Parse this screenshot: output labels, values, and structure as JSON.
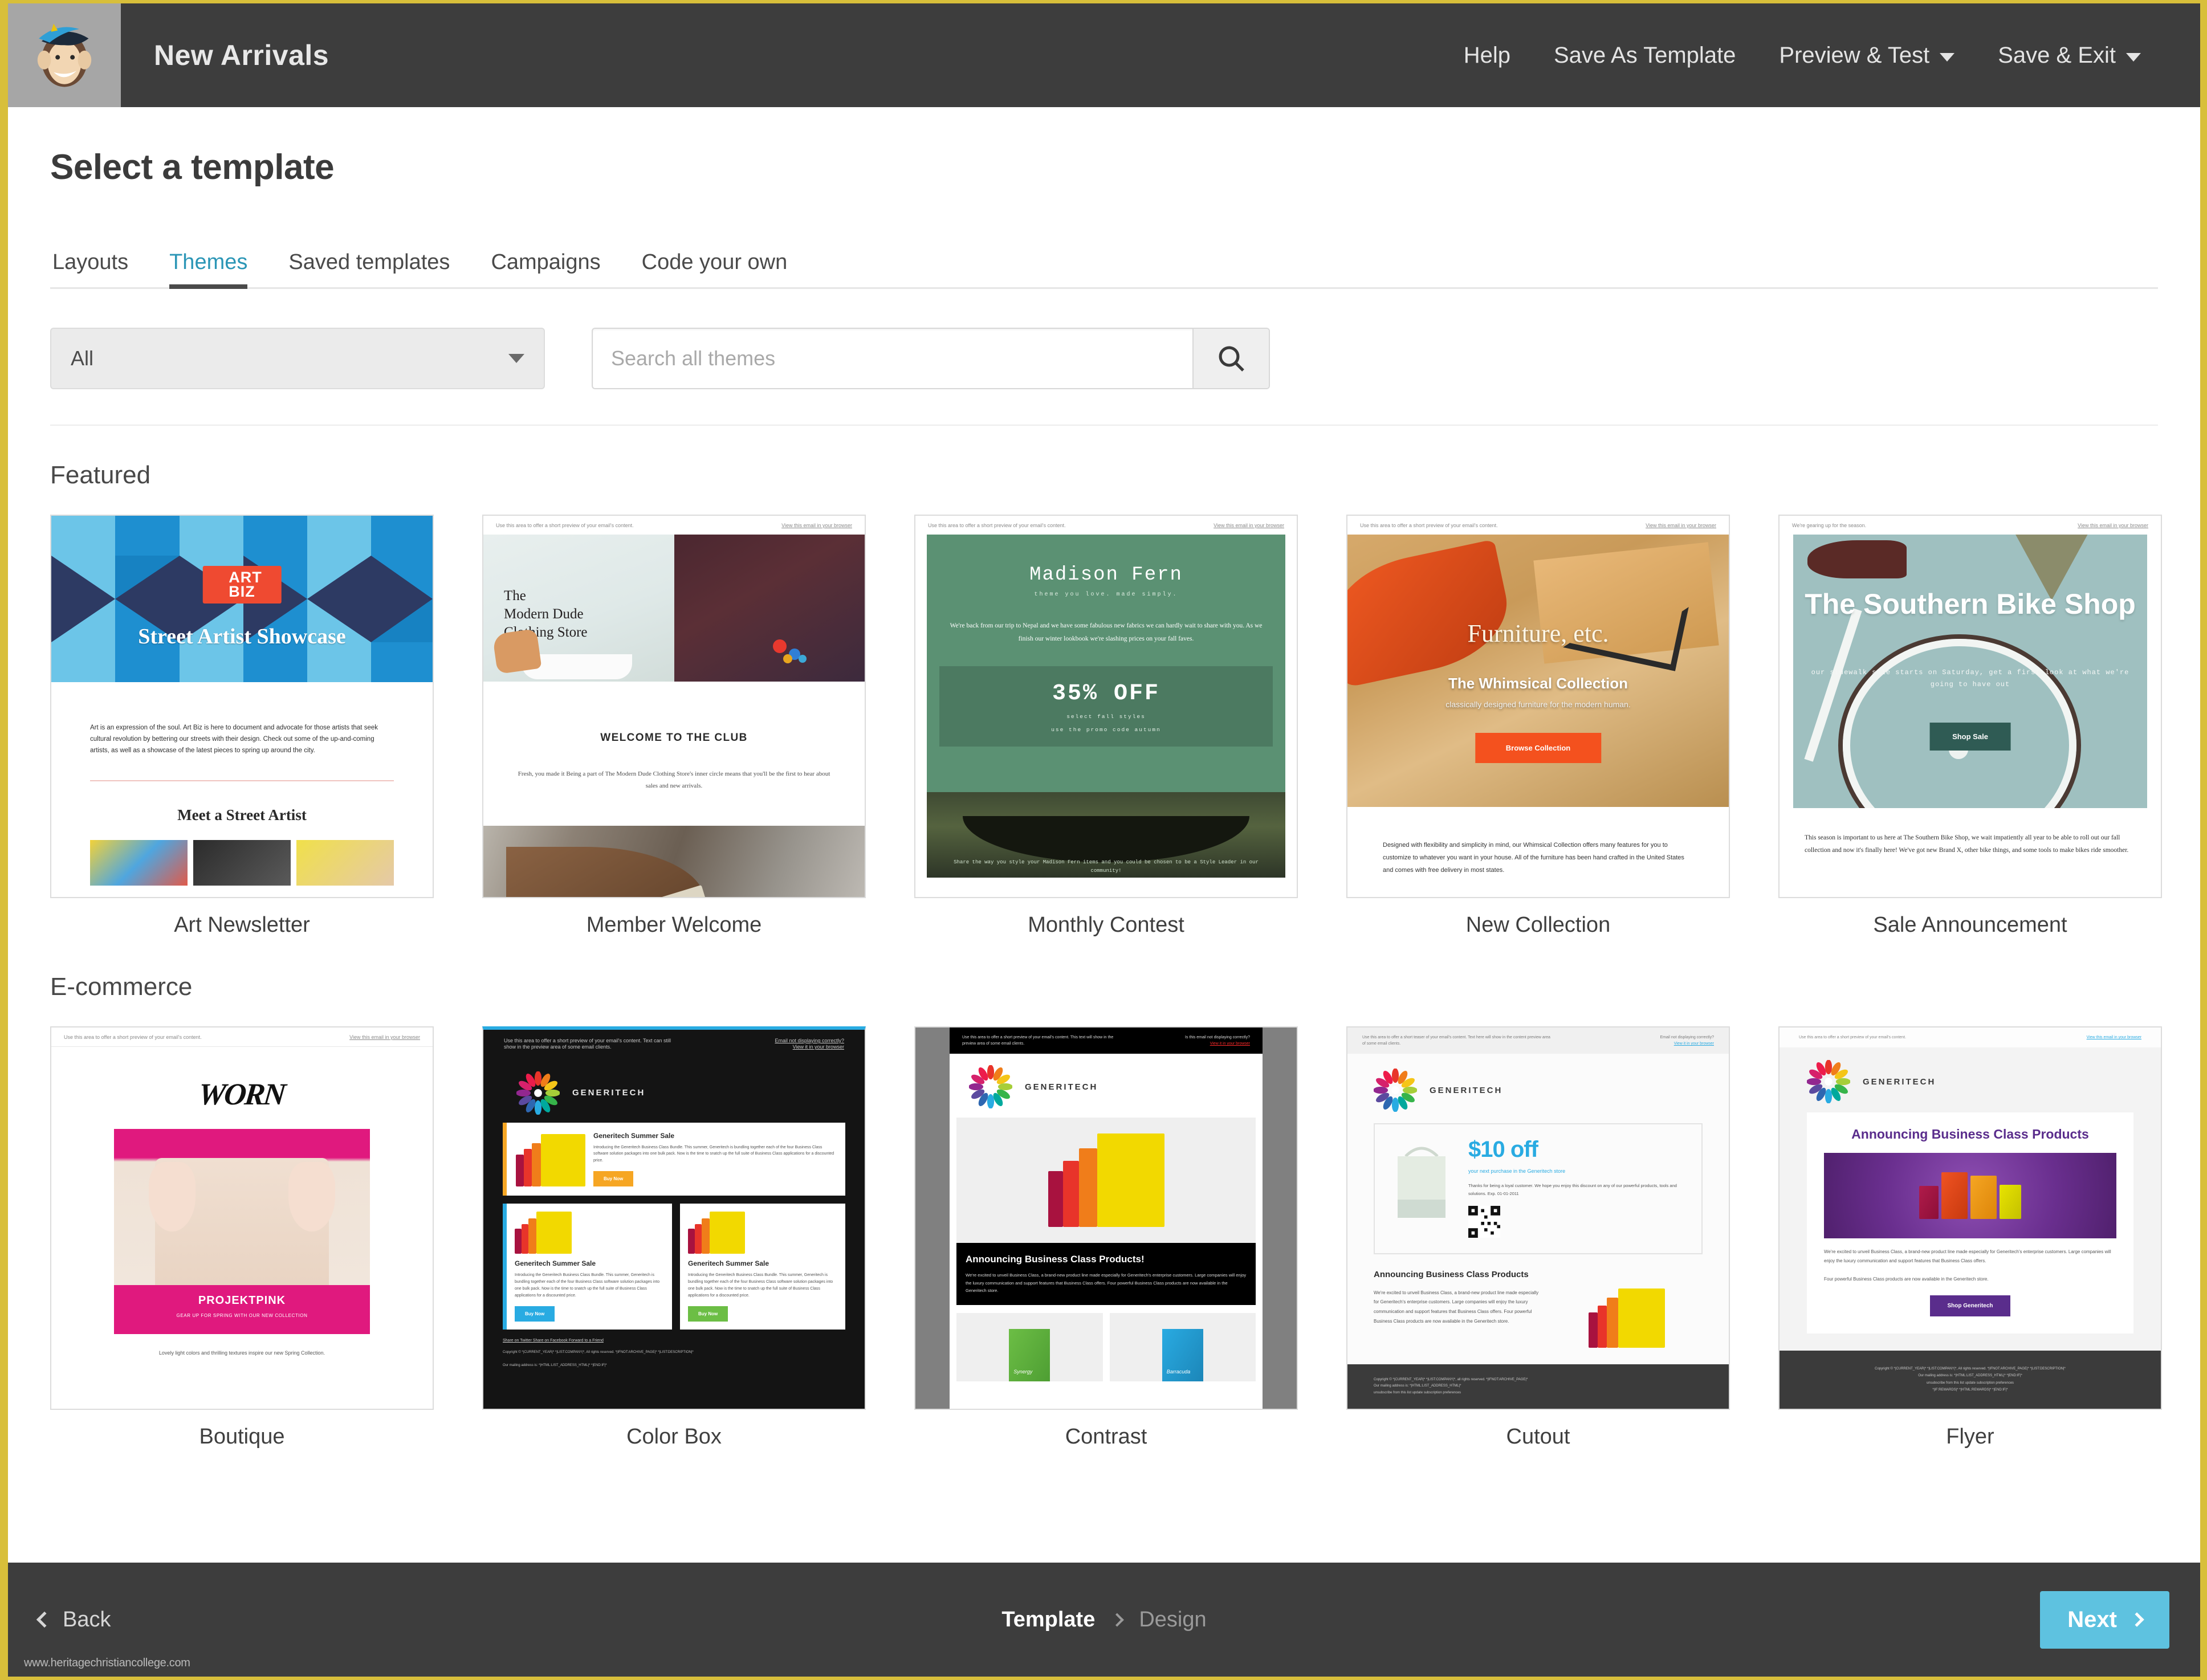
{
  "header": {
    "campaign_name": "New Arrivals",
    "logo_alt": "mailchimp-freddie-logo",
    "nav": [
      {
        "label": "Help",
        "caret": false
      },
      {
        "label": "Save As Template",
        "caret": false
      },
      {
        "label": "Preview & Test",
        "caret": true
      },
      {
        "label": "Save & Exit",
        "caret": true
      }
    ]
  },
  "page": {
    "title": "Select a template"
  },
  "tabs": [
    {
      "label": "Layouts",
      "active": false
    },
    {
      "label": "Themes",
      "active": true
    },
    {
      "label": "Saved templates",
      "active": false
    },
    {
      "label": "Campaigns",
      "active": false
    },
    {
      "label": "Code your own",
      "active": false
    }
  ],
  "filters": {
    "category_value": "All",
    "search_value": "",
    "search_placeholder": "Search all themes",
    "search_button_icon": "search-icon"
  },
  "sections": [
    {
      "title": "Featured",
      "templates": [
        {
          "name": "Art Newsletter",
          "preview": {
            "logo_line1": "ART",
            "logo_line2": "BIZ",
            "hero_title": "Street Artist Showcase",
            "body": "Art is an expression of the soul. Art Biz is here to document and advocate for those artists that seek cultural revolution by bettering our streets with their design. Check out some of the up-and-coming artists, as well as a showcase of the latest pieces to spring up around the city.",
            "heading2": "Meet a Street Artist"
          }
        },
        {
          "name": "Member Welcome",
          "preview": {
            "preheader": "Use this area to offer a short preview of your email's content.",
            "view_link": "View this email in your browser",
            "brand": "The\nModern Dude\nClothing Store",
            "heading": "WELCOME TO THE CLUB",
            "body": "Fresh, you made it\nBeing a part of The Modern Dude Clothing Store's inner circle means that you'll be the first to hear about sales and new arrivals."
          }
        },
        {
          "name": "Monthly Contest",
          "preview": {
            "preheader": "Use this area to offer a short preview of your email's content.",
            "view_link": "View this email in your browser",
            "title": "Madison Fern",
            "tagline": "theme you love. made simply.",
            "body": "We're back from our trip to Nepal and we have some fabulous new fabrics we can hardly wait to share with you. As we finish our winter lookbook we're slashing prices on your fall faves.",
            "offer": "35% OFF",
            "offer_line1": "select fall styles",
            "offer_line2": "use the promo code autumn",
            "caption": "Share the way you style your Madison Fern items and you could be chosen to be a Style Leader in our community!"
          }
        },
        {
          "name": "New Collection",
          "preview": {
            "preheader": "Use this area to offer a short preview of your email's content.",
            "view_link": "View this email in your browser",
            "title": "Furniture, etc.",
            "subtitle": "The Whimsical Collection",
            "tagline": "classically designed furniture for the modern human.",
            "button": "Browse Collection",
            "body": "Designed with flexibility and simplicity in mind, our Whimsical Collection offers many features for you to customize to whatever you want in your house. All of the furniture has been hand crafted in the United States and comes with free delivery in most states."
          }
        },
        {
          "name": "Sale Announcement",
          "preview": {
            "preheader": "We're gearing up for the season.",
            "view_link": "View this email in your browser",
            "title": "The Southern Bike Shop",
            "subtitle": "our sidewalk sale starts on Saturday, get a first look at what we're going to have out",
            "button": "Shop Sale",
            "body": "This season is important to us here at The Southern Bike Shop, we wait impatiently all year to be able to roll out our fall collection and now it's finally here! We've got new Brand X, other bike things, and some tools to make bikes ride smoother."
          }
        }
      ]
    },
    {
      "title": "E-commerce",
      "templates": [
        {
          "name": "Boutique",
          "preview": {
            "preheader": "Use this area to offer a short preview of your email's content.",
            "view_link": "View this email in your browser",
            "logo": "WORN",
            "band_title": "PROJEKTPINK",
            "band_sub": "GEAR UP FOR SPRING WITH OUR NEW COLLECTION",
            "caption": "Lovely light colors and thrilling textures inspire our new Spring Collection."
          }
        },
        {
          "name": "Color Box",
          "preview": {
            "preheader": "Use this area to offer a short preview of your email's content. Text can still show in the preview area of some email clients.",
            "view_link1": "Email not displaying correctly?",
            "view_link2": "View it in your browser",
            "brand": "GENERITECH",
            "card_title": "Generitech Summer Sale",
            "card_body": "Introducing the Generitech Business Class Bundle. This summer, Generitech is bundling together each of the four Business Class software solution packages into one bulk pack. Now is the time to snatch up the full suite of Business Class applications for a discounted price.",
            "button": "Buy Now",
            "footer_links": "Share on Twitter   Share on Facebook   Forward to a Friend",
            "legal": "Copyright © *|CURRENT_YEAR|* *|LIST:COMPANY|*, All rights reserved.\n*|IFNOT:ARCHIVE_PAGE|* *|LIST:DESCRIPTION|*",
            "address": "Our mailing address is:\n*|HTML:LIST_ADDRESS_HTML|* *|END:IF|*"
          }
        },
        {
          "name": "Contrast",
          "preview": {
            "preheader": "Use this area to offer a short preview of your email's content. This text will show in the preview area of some email clients.",
            "view_link1": "Is this email not displaying correctly?",
            "view_link2": "View it in your browser",
            "brand": "GENERITECH",
            "heading": "Announcing Business Class Products!",
            "body": "We're excited to unveil Business Class, a brand-new product line made especially for Generitech's enterprise customers. Large companies will enjoy the luxury communication and support features that Business Class offers. Four powerful Business Class products are now available in the Generitech store.",
            "product1": "Synergy",
            "product2": "Barracuda"
          }
        },
        {
          "name": "Cutout",
          "preview": {
            "preheader": "Use this area to offer a short teaser of your email's content. Text here will show in the content preview area of some email clients.",
            "view_link1": "Email not displaying correctly?",
            "view_link2": "View it in your browser",
            "brand": "GENERITECH",
            "offer": "$10 off",
            "offer_sub": "your next purchase in the Generitech store",
            "offer_body": "Thanks for being a loyal customer. We hope you enjoy this discount on any of our powerful products, tools and solutions. Exp. 01-01-2011",
            "heading": "Announcing Business Class Products",
            "body": "We're excited to unveil Business Class, a brand-new product line made especially for Generitech's enterprise customers. Large companies will enjoy the luxury communication and support features that Business Class offers. Four powerful Business Class products are now available in the Generitech store.",
            "legal": "Copyright © *|CURRENT_YEAR|* *|LIST:COMPANY|*, all rights reserved.\n*|IFNOT:ARCHIVE_PAGE|*",
            "legal2": "*|LIST:DESCRIPTION|* *|HTML:LIST_ADDRESS_HTML|* *|END:IF|*",
            "address": "Our mailing address is:\n*|HTML:LIST_ADDRESS_HTML|*",
            "unsubscribe": "unsubscribe from this list   update subscription preferences"
          }
        },
        {
          "name": "Flyer",
          "preview": {
            "preheader": "Use this area to offer a short preview of your email's content.",
            "view_link": "View this email in your browser",
            "brand": "GENERITECH",
            "heading": "Announcing Business Class Products",
            "body1": "We're excited to unveil Business Class, a brand-new product line made especially for Generitech's enterprise customers. Large companies will enjoy the luxury communication and support features that Business Class offers.",
            "body2": "Four powerful Business Class products are now available in the Generitech store.",
            "button": "Shop Generitech",
            "legal": "Copyright © *|CURRENT_YEAR|* *|LIST:COMPANY|*, All rights reserved.\n*|IFNOT:ARCHIVE_PAGE|* *|LIST:DESCRIPTION|*",
            "address": "Our mailing address is:\n*|HTML:LIST_ADDRESS_HTML|* *|END:IF|*",
            "unsubscribe": "unsubscribe from this list   update subscription preferences",
            "tail": "*|IF:REWARDS|* *|HTML:REWARDS|* *|END:IF|*"
          }
        }
      ]
    }
  ],
  "footer": {
    "back_label": "Back",
    "breadcrumb_current": "Template",
    "breadcrumb_next": "Design",
    "next_label": "Next",
    "watermark": "www.heritagechristiancollege.com"
  },
  "colors": {
    "accent_teal": "#2b96b6",
    "next_button": "#5ec2e0",
    "chrome_dark": "#3d3d3d",
    "page_border": "#d8bf3a"
  }
}
